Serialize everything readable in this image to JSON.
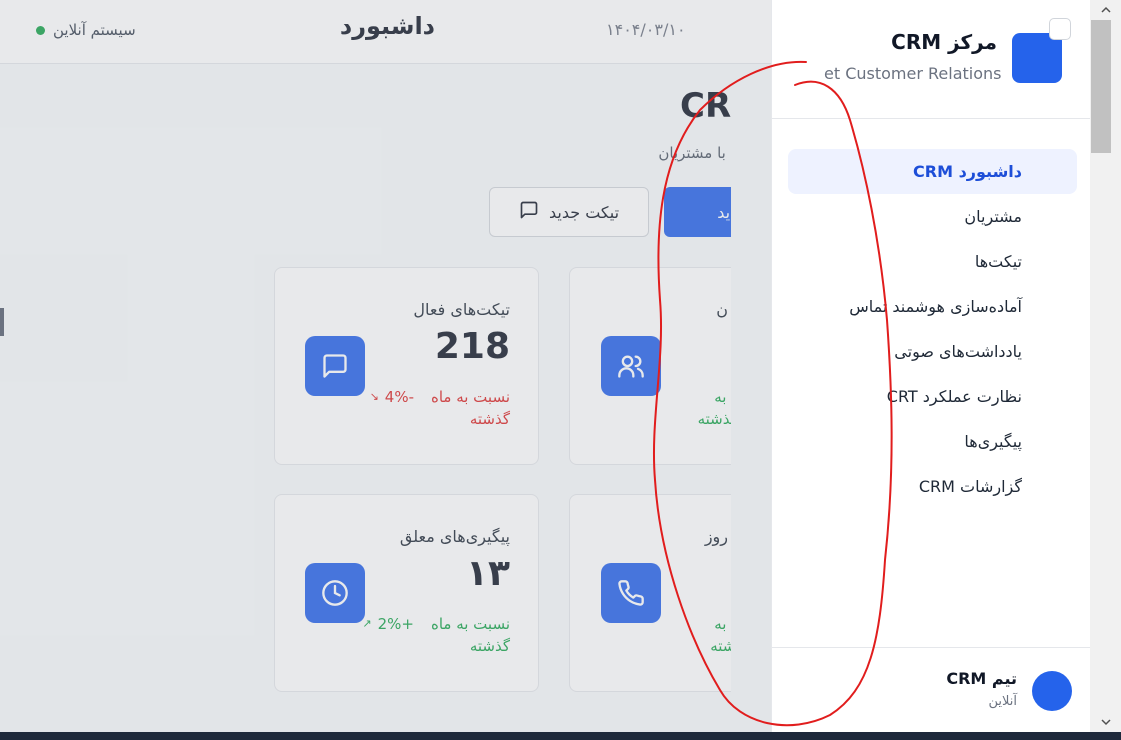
{
  "header": {
    "title": "داشبورد",
    "date": "۱۴۰۴/۰۳/۱۰",
    "status": "سیستم آنلاین",
    "status_color": "#16a34a"
  },
  "main": {
    "page_title_fragment": "CR",
    "subtitle_fragment": "ند ارتباط با مشتریان",
    "new_ticket_label": "تیکت جدید",
    "primary_button_fragment": "ی جدید"
  },
  "cards": [
    {
      "label": "تیکت‌های فعال",
      "value": "218",
      "change": "-4%",
      "change_text": "نسبت به ماه گذشته",
      "trend": "down",
      "icon": "message-icon"
    },
    {
      "label": "ن",
      "value": "",
      "change": "",
      "change_text": "سبت به\nماه گذشته",
      "trend": "up",
      "icon": "users-icon"
    },
    {
      "label": "پیگیری‌های معلق",
      "value": "۱۳",
      "change": "+2%",
      "change_text": "نسبت به ماه گذشته",
      "trend": "up",
      "icon": "clock-icon"
    },
    {
      "label": "روز",
      "value": "",
      "change": "",
      "change_text": "سبت به\nه گذشته",
      "trend": "up",
      "icon": "phone-icon"
    }
  ],
  "sidebar": {
    "title": "مرکز CRM",
    "subtitle": "et Customer Relations",
    "accent": "#2563eb",
    "items": [
      {
        "label": "داشبورد CRM",
        "active": true
      },
      {
        "label": "مشتریان",
        "active": false
      },
      {
        "label": "تیکت‌ها",
        "active": false
      },
      {
        "label": "آماده‌سازی هوشمند تماس",
        "active": false
      },
      {
        "label": "یادداشت‌های صوتی",
        "active": false
      },
      {
        "label": "نظارت عملکرد CRT",
        "active": false
      },
      {
        "label": "پیگیری‌ها",
        "active": false
      },
      {
        "label": "گزارشات CRM",
        "active": false
      }
    ],
    "footer": {
      "name": "تیم CRM",
      "status": "آنلاین"
    }
  }
}
